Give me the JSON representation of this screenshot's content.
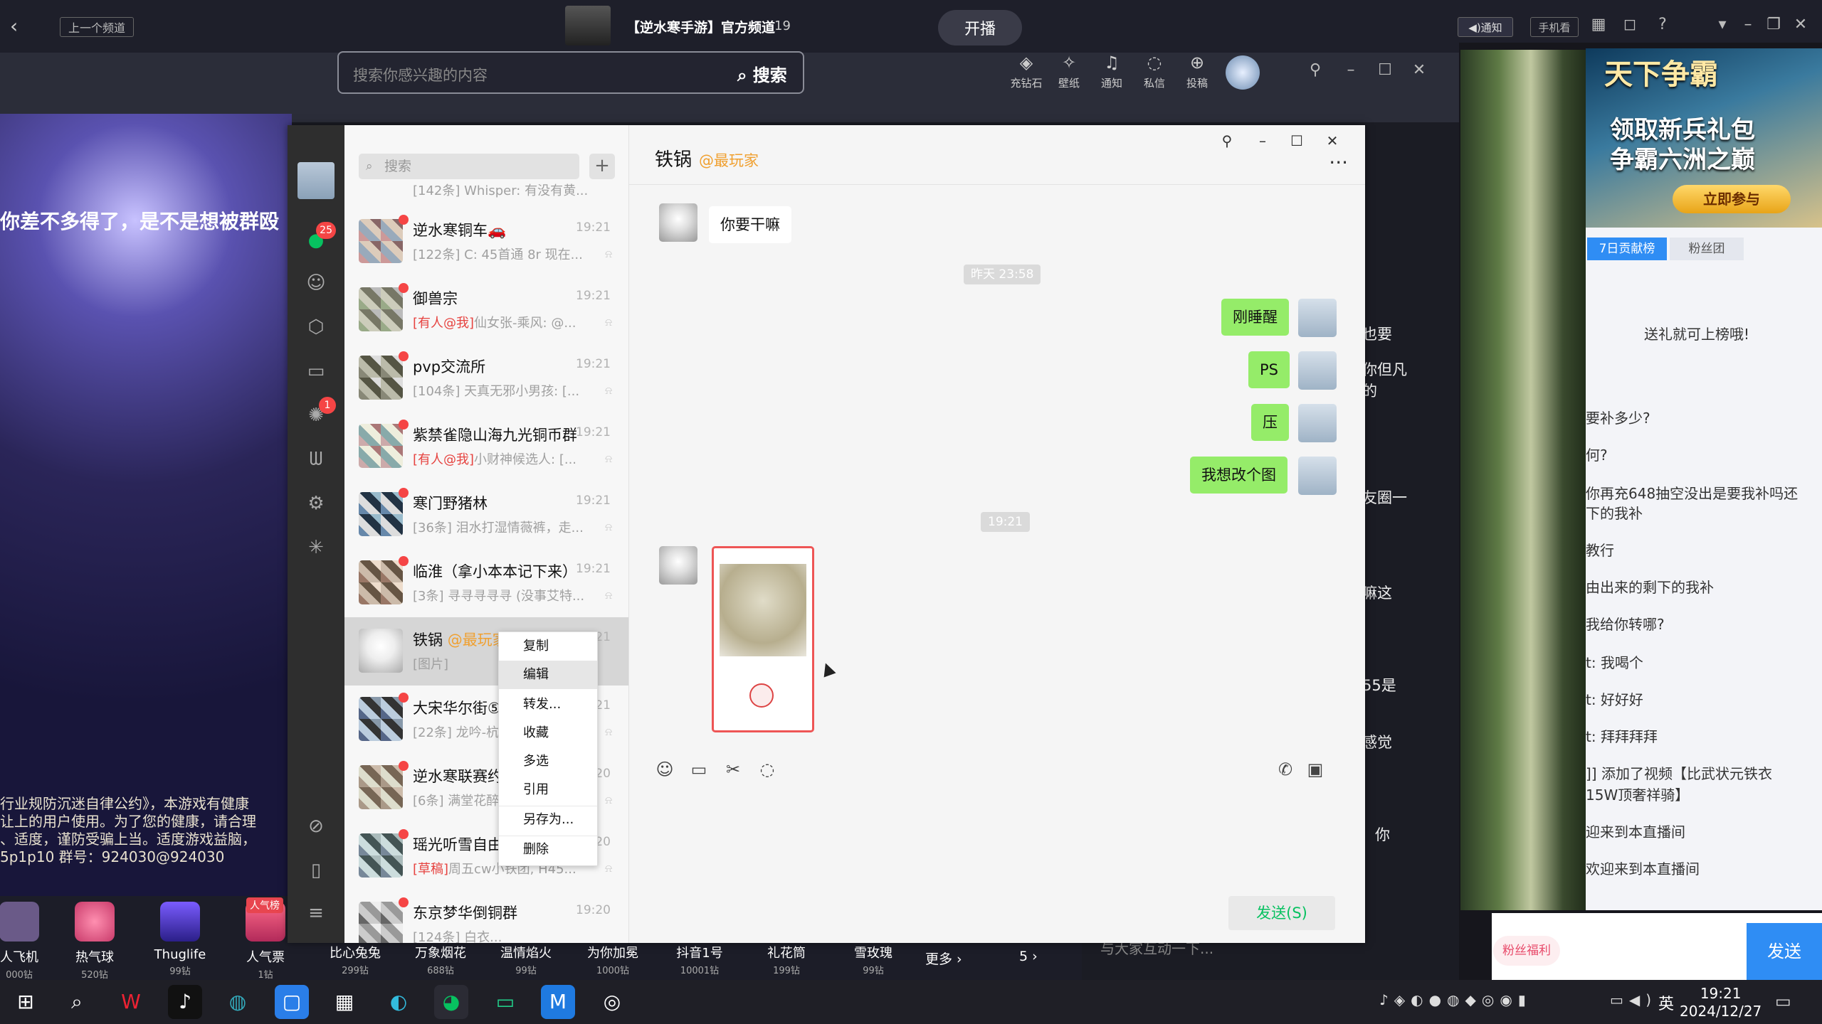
{
  "top_bar": {
    "prev_channel": "上一个频道",
    "channel_title": "【逆水寒手游】官方频道",
    "channel_count": "19",
    "start_live": "开播",
    "notify": "◀)通知",
    "mobile": "手机看"
  },
  "stream_search": {
    "placeholder": "搜索你感兴趣的内容",
    "button": "搜索"
  },
  "stream_nav": [
    {
      "icon": "diamond-icon",
      "label": "充钻石"
    },
    {
      "icon": "wallpaper-icon",
      "label": "壁纸"
    },
    {
      "icon": "bell-icon",
      "label": "通知"
    },
    {
      "icon": "chat-bubble-icon",
      "label": "私信"
    },
    {
      "icon": "upload-icon",
      "label": "投稿"
    }
  ],
  "live": {
    "overlay_text": "你差不多得了，是不是想被群殴",
    "notice_lines": [
      "行业规防沉迷自律公约》，本游戏有健康",
      "让上的用户使用。为了您的健康，请合理",
      "、适度，谨防受骗上当。适度游戏益脑，",
      "5p1p10  群号：924030@924030"
    ]
  },
  "gifts": [
    {
      "name": "人飞机",
      "price": "000钻"
    },
    {
      "name": "热气球",
      "price": "520钻"
    },
    {
      "name": "Thuglife",
      "price": "99钻"
    },
    {
      "name": "人气票",
      "price": "1钻",
      "tag": "人气榜"
    },
    {
      "name": "比心兔兔",
      "price": "299钻"
    },
    {
      "name": "万象烟花",
      "price": "688钻"
    },
    {
      "name": "温情焰火",
      "price": "99钻"
    },
    {
      "name": "为你加冕",
      "price": "1000钻"
    },
    {
      "name": "抖音1号",
      "price": "10001钻"
    },
    {
      "name": "礼花筒",
      "price": "199钻"
    },
    {
      "name": "雪玫瑰",
      "price": "99钻"
    }
  ],
  "gifts_more": "更多 ›",
  "gifts_page": "5 ›",
  "right_panel": {
    "ad_title": "天下争霸",
    "ad_line1": "领取新兵礼包",
    "ad_line2": "争霸六洲之巅",
    "ad_button": "立即参与",
    "tab1": "7日贡献榜",
    "tab2": "粉丝团",
    "gift_hint": "送礼就可上榜哦!",
    "messages": [
      "要补多少?",
      "何?",
      "你再充648抽空没出是要我补吗还",
      "下的我补",
      "教行",
      "由出来的剩下的我补",
      "我给你转哪?",
      "t: 我喝个",
      "t: 好好好",
      "t: 拜拜拜拜",
      "]] 添加了视频【比武状元铁衣",
      "15W顶奢祥骑】",
      "迎来到本直播间",
      "欢迎来到本直播间"
    ],
    "fan_badge": "粉丝福利",
    "send": "发送",
    "input_placeholder": "与大家互动一下..."
  },
  "bg_fragments": [
    "也要",
    "你但凡",
    "的",
    "友圈一",
    "嘛这",
    "55是",
    "感觉",
    "你"
  ],
  "wechat": {
    "search_placeholder": "搜索",
    "rail_badges": {
      "chats": "25",
      "moments": "1"
    },
    "conversations": [
      {
        "name": "",
        "time": "",
        "preview": "[142条] Whisper: 有没有黄...",
        "at": ""
      },
      {
        "name": "逆水寒铜车🚗",
        "time": "19:21",
        "preview": "[122条] C: 45首通 8r 现在...",
        "at": ""
      },
      {
        "name": "御兽宗",
        "time": "19:21",
        "preview": "仙女张-乘风: @...",
        "at": "[有人@我]"
      },
      {
        "name": "pvp交流所",
        "time": "19:21",
        "preview": "[104条] 天真无邪小男孩: [...",
        "at": ""
      },
      {
        "name": "紫禁雀隐山海九光铜币群",
        "time": "19:21",
        "preview": "小财神候选人: [...",
        "at": "[有人@我]"
      },
      {
        "name": "寒门野猪林",
        "time": "19:21",
        "preview": "[36条] 泪水打湿情薇裤，走...",
        "at": ""
      },
      {
        "name": "临淮（拿小本本记下来）",
        "time": "19:21",
        "preview": "[3条] 寻寻寻寻寻 (没事艾特...",
        "at": ""
      },
      {
        "name": "铁锅",
        "time": "19:21",
        "preview": "[图片]",
        "at": "",
        "tag": "@最玩家"
      },
      {
        "name": "大宋华尔街⑤",
        "time": "19:21",
        "preview": "[22条] 龙吟-杭州下小雨: 九...",
        "at": ""
      },
      {
        "name": "逆水寒联赛约战拼车群",
        "time": "19:20",
        "preview": "[6条] 满堂花醉 刻丹: 甲几...",
        "at": ""
      },
      {
        "name": "瑶光听雪自由交易市场",
        "time": "19:20",
        "preview": "周五cw小铁团, H45...",
        "at": "[草稿]"
      },
      {
        "name": "东京梦华倒铜群",
        "time": "19:20",
        "preview": "[124条] 白衣...",
        "at": ""
      }
    ],
    "chat": {
      "title": "铁锅",
      "title_tag": "@最玩家",
      "msg_in_1": "你要干嘛",
      "stamp_1": "昨天 23:58",
      "out_1": "刚睡醒",
      "out_2": "PS",
      "out_3": "压",
      "out_4": "我想改个图",
      "stamp_2": "19:21",
      "send_button": "发送(S)"
    },
    "context_menu": [
      "复制",
      "编辑",
      "转发...",
      "收藏",
      "多选",
      "引用",
      "另存为...",
      "删除"
    ]
  },
  "taskbar": {
    "ime": "英",
    "time": "19:21",
    "date": "2024/12/27"
  }
}
